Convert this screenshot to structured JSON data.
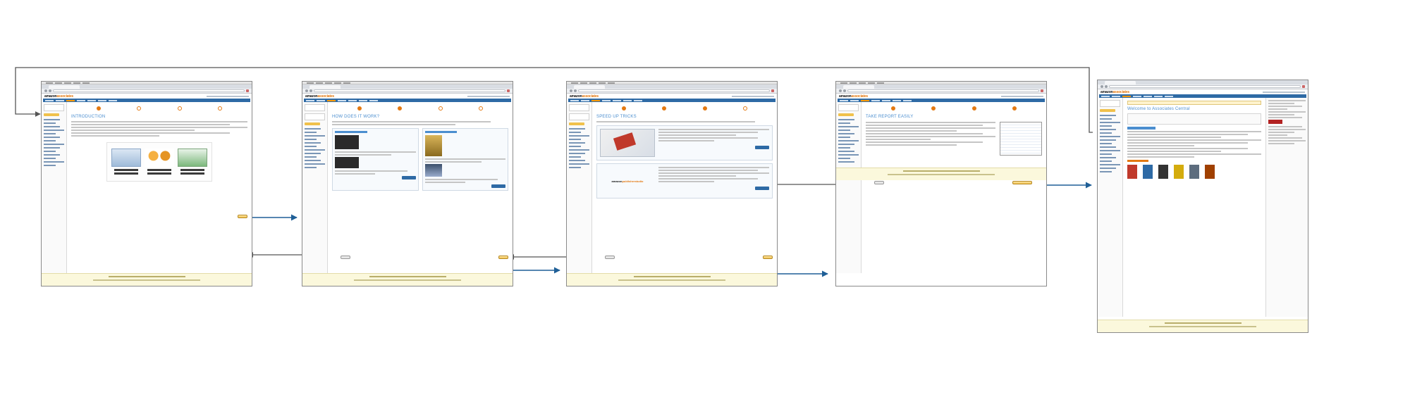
{
  "flow": {
    "screens": [
      {
        "id": "introduction",
        "title": "INTRODUCTION",
        "promo_captions": [
          "Advertise products on your web page",
          "People follow the link to Amazon",
          "Earn up to 15% when they buy"
        ]
      },
      {
        "id": "how-does-it-work",
        "title": "HOW DOES IT WORK?"
      },
      {
        "id": "speed-up-tricks",
        "title": "SPEED UP TRICKS"
      },
      {
        "id": "take-report-easily",
        "title": "TAKE REPORT EASILY"
      },
      {
        "id": "welcome",
        "title": "Welcome to Associates Central"
      }
    ],
    "brand": {
      "name_dark": "amazon",
      "name_accent": "associates"
    },
    "colors": {
      "forward_arrow": "#1f5f97",
      "back_arrow": "#555555",
      "loop_arrow": "#555555",
      "accent": "#e47911",
      "title_blue": "#4b8ecf",
      "nav_blue": "#2e6aa5"
    }
  }
}
